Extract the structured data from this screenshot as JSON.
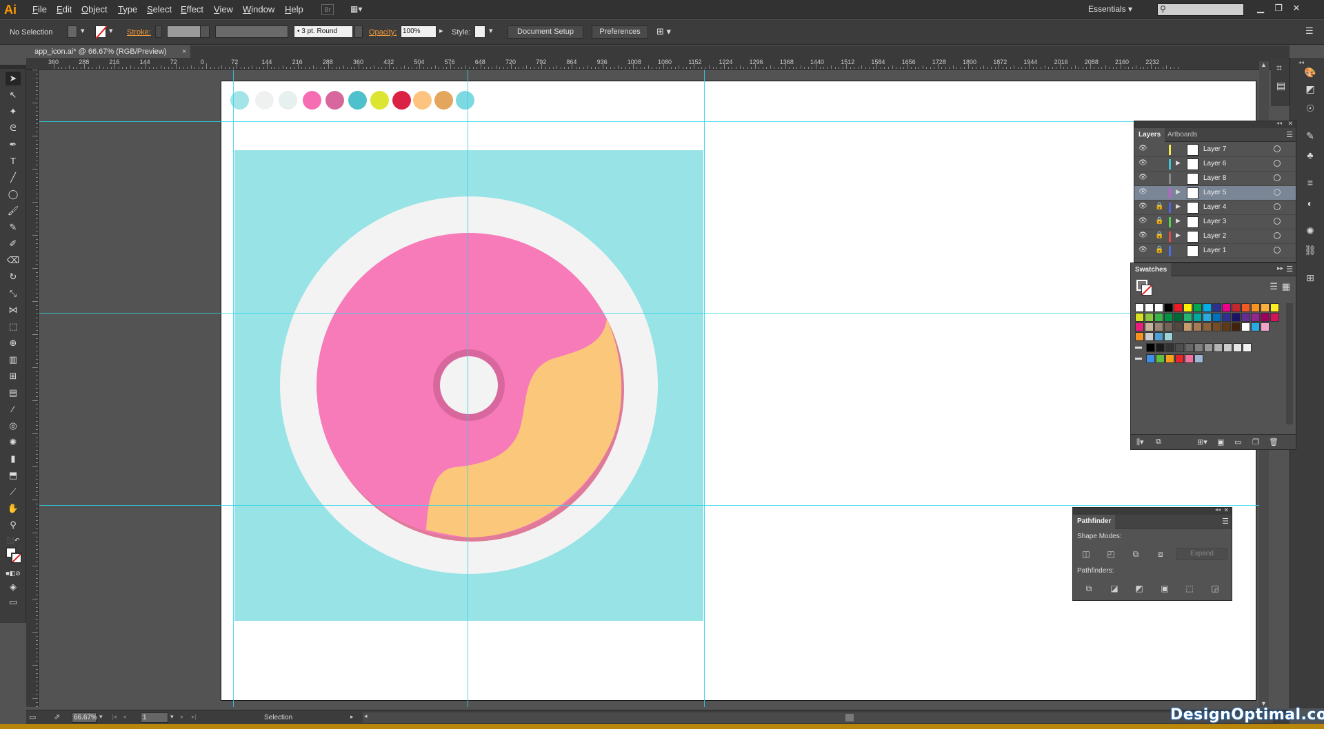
{
  "app": {
    "logo": "Ai"
  },
  "menu": [
    "File",
    "Edit",
    "Object",
    "Type",
    "Select",
    "Effect",
    "View",
    "Window",
    "Help"
  ],
  "br_button": "Br",
  "workspace": "Essentials",
  "control": {
    "selection": "No Selection",
    "stroke_label": "Stroke:",
    "brush": "3 pt. Round",
    "opacity_label": "Opacity:",
    "opacity_value": "100%",
    "style_label": "Style:",
    "document_setup": "Document Setup",
    "preferences": "Preferences"
  },
  "document": {
    "tab_title": "app_icon.ai* @ 66.67% (RGB/Preview)",
    "close": "×"
  },
  "ruler_labels": [
    "360",
    "288",
    "216",
    "144",
    "72",
    "0",
    "72",
    "144",
    "216",
    "288",
    "360",
    "432",
    "504",
    "576",
    "648",
    "720",
    "792",
    "864",
    "936",
    "1008",
    "1080",
    "1152",
    "1224",
    "1296",
    "1368",
    "1440",
    "1512",
    "1584",
    "1656",
    "1728",
    "1800",
    "1872",
    "1944",
    "2016",
    "2088",
    "2160",
    "2232"
  ],
  "palette": {
    "colors": [
      "#a2e4e8",
      "#eff1f1",
      "#e6f0ee",
      "#f76db4",
      "#d8679e",
      "#4fc1cc",
      "#dce532",
      "#dc2244",
      "#fcc47e",
      "#e4a55d",
      "#7dd8e0"
    ]
  },
  "icon": {
    "tile_color": "#98e3e6",
    "plate_color": "#f3f3f3",
    "donut_color": "#f77ab9",
    "donut_shadow": "#df7a98",
    "dough_color": "#fbc87b",
    "hole_ring": "#d8679e"
  },
  "layers_panel": {
    "tabs": [
      "Layers",
      "Artboards"
    ],
    "layers": [
      {
        "name": "Layer 7",
        "color": "#f6ea4c",
        "locked": false,
        "expand": false,
        "selected": false
      },
      {
        "name": "Layer 6",
        "color": "#38c8d8",
        "locked": false,
        "expand": true,
        "selected": false
      },
      {
        "name": "Layer 8",
        "color": "#8a8a8a",
        "locked": false,
        "expand": false,
        "selected": false
      },
      {
        "name": "Layer 5",
        "color": "#c65bd6",
        "locked": false,
        "expand": true,
        "selected": true
      },
      {
        "name": "Layer 4",
        "color": "#5560e8",
        "locked": true,
        "expand": true,
        "selected": false
      },
      {
        "name": "Layer 3",
        "color": "#4fd84f",
        "locked": true,
        "expand": true,
        "selected": false
      },
      {
        "name": "Layer 2",
        "color": "#e84848",
        "locked": true,
        "expand": true,
        "selected": false
      },
      {
        "name": "Layer 1",
        "color": "#4870e8",
        "locked": true,
        "expand": false,
        "selected": false
      }
    ]
  },
  "swatches_panel": {
    "title": "Swatches",
    "rows": [
      [
        "#ffffff",
        "#ffffff",
        "#ffffff",
        "#000000",
        "#ed1c24",
        "#fff200",
        "#00a651",
        "#00aeef",
        "#2e3192",
        "#ec008c",
        "#c1272d",
        "#f15a24",
        "#f7931e",
        "#fbb03b",
        "#fcee21"
      ],
      [
        "#d9e021",
        "#8cc63f",
        "#39b54a",
        "#009245",
        "#006837",
        "#22b573",
        "#00a99d",
        "#29abe2",
        "#0071bc",
        "#2e3192",
        "#1b1464",
        "#662d91",
        "#93278f",
        "#9e005d",
        "#d4145a"
      ],
      [
        "#ed1e79",
        "#c7b299",
        "#998675",
        "#736357",
        "#534741",
        "#c69c6d",
        "#a67c52",
        "#8c6239",
        "#754c24",
        "#603813",
        "#42210b",
        "#ffffff",
        "#29abe2",
        "#f2a4c8"
      ],
      [
        "#f7931e",
        "#cccccc",
        "#4d9fd6",
        "#9dd2d8"
      ],
      [
        "#000000",
        "#1a1a1a",
        "#333333",
        "#4d4d4d",
        "#666666",
        "#808080",
        "#999999",
        "#b3b3b3",
        "#cccccc",
        "#e6e6e6",
        "#f2f2f2"
      ],
      [
        "#3f8fe8",
        "#5fbf3f",
        "#f7a11a",
        "#e8262a",
        "#f46fa0",
        "#a0b8d8"
      ]
    ]
  },
  "pathfinder_panel": {
    "title": "Pathfinder",
    "shape_modes": "Shape Modes:",
    "expand": "Expand",
    "pathfinders": "Pathfinders:"
  },
  "status": {
    "zoom": "66.67%",
    "page": "1",
    "tool": "Selection"
  },
  "watermark": "DesignOptimal.com"
}
